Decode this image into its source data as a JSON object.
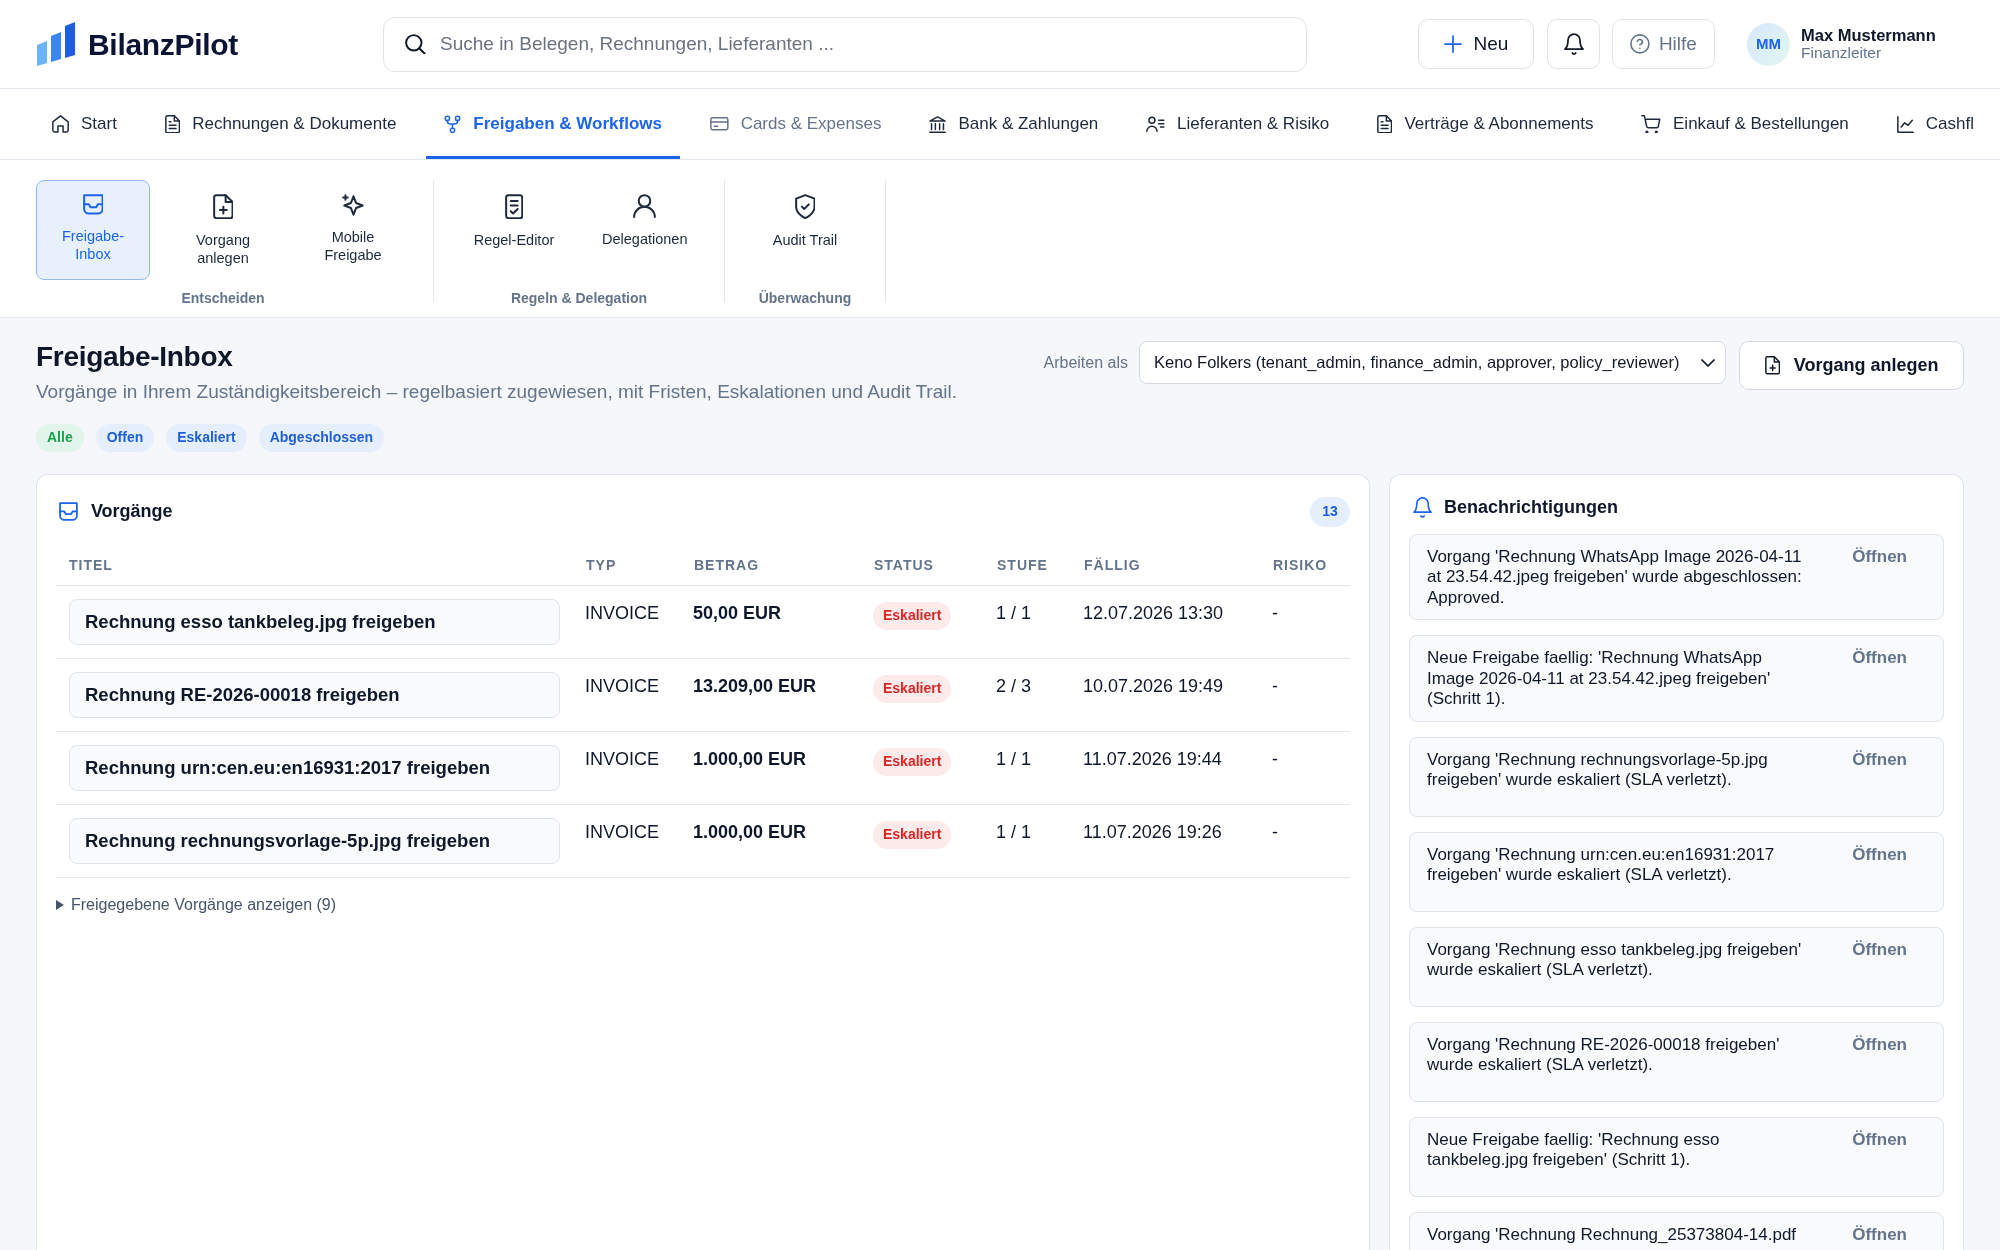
{
  "header": {
    "logo": "BilanzPilot",
    "search": {
      "placeholder": "Suche in Belegen, Rechnungen, Lieferanten ..."
    },
    "new_button": "Neu",
    "help_button": "Hilfe",
    "user": {
      "initials": "MM",
      "name": "Max Mustermann",
      "role": "Finanzleiter"
    }
  },
  "nav": [
    {
      "label": "Start",
      "selected": false,
      "disabled": false
    },
    {
      "label": "Rechnungen & Dokumente",
      "selected": false,
      "disabled": false
    },
    {
      "label": "Freigaben & Workflows",
      "selected": true,
      "disabled": false
    },
    {
      "label": "Cards & Expenses",
      "selected": false,
      "disabled": true
    },
    {
      "label": "Bank & Zahlungen",
      "selected": false,
      "disabled": false
    },
    {
      "label": "Lieferanten & Risiko",
      "selected": false,
      "disabled": false
    },
    {
      "label": "Verträge & Abonnements",
      "selected": false,
      "disabled": false
    },
    {
      "label": "Einkauf & Bestellungen",
      "selected": false,
      "disabled": false
    },
    {
      "label": "Cashfl",
      "selected": false,
      "disabled": false
    }
  ],
  "ribbon": [
    {
      "label": "Entscheiden",
      "items": [
        {
          "label": "Freigabe-Inbox",
          "selected": true
        },
        {
          "label": "Vorgang anlegen",
          "selected": false
        },
        {
          "label": "Mobile Freigabe",
          "selected": false
        }
      ]
    },
    {
      "label": "Regeln & Delegation",
      "items": [
        {
          "label": "Regel-Editor",
          "selected": false
        },
        {
          "label": "Delegationen",
          "selected": false
        }
      ]
    },
    {
      "label": "Überwachung",
      "items": [
        {
          "label": "Audit Trail",
          "selected": false
        }
      ]
    }
  ],
  "page": {
    "title": "Freigabe-Inbox",
    "subtitle": "Vorgänge in Ihrem Zuständigkeitsbereich – regelbasiert zugewiesen, mit Fristen, Eskalationen und Audit Trail.",
    "filters": [
      {
        "label": "Alle",
        "selected": true
      },
      {
        "label": "Offen",
        "selected": false
      },
      {
        "label": "Eskaliert",
        "selected": false
      },
      {
        "label": "Abgeschlossen",
        "selected": false
      }
    ],
    "acting_as": {
      "label": "Arbeiten als",
      "value": "Keno Folkers (tenant_admin, finance_admin, approver, policy_reviewer)"
    },
    "create_button": "Vorgang anlegen"
  },
  "cases": {
    "title": "Vorgänge",
    "count": "13",
    "columns": [
      "TITEL",
      "TYP",
      "BETRAG",
      "STATUS",
      "STUFE",
      "FÄLLIG",
      "RISIKO"
    ],
    "rows": [
      {
        "title": "Rechnung esso tankbeleg.jpg freigeben",
        "type": "INVOICE",
        "amount": "50,00 EUR",
        "status": "Eskaliert",
        "stage": "1 / 1",
        "due": "12.07.2026 13:30",
        "risk": "-"
      },
      {
        "title": "Rechnung RE-2026-00018 freigeben",
        "type": "INVOICE",
        "amount": "13.209,00 EUR",
        "status": "Eskaliert",
        "stage": "2 / 3",
        "due": "10.07.2026 19:49",
        "risk": "-"
      },
      {
        "title": "Rechnung urn:cen.eu:en16931:2017 freigeben",
        "type": "INVOICE",
        "amount": "1.000,00 EUR",
        "status": "Eskaliert",
        "stage": "1 / 1",
        "due": "11.07.2026 19:44",
        "risk": "-"
      },
      {
        "title": "Rechnung rechnungsvorlage-5p.jpg freigeben",
        "type": "INVOICE",
        "amount": "1.000,00 EUR",
        "status": "Eskaliert",
        "stage": "1 / 1",
        "due": "11.07.2026 19:26",
        "risk": "-"
      }
    ],
    "completed_toggle": {
      "label": "Freigegebene Vorgänge anzeigen (9)",
      "expanded": false
    }
  },
  "notifications": {
    "title": "Benachrichtigungen",
    "items": [
      {
        "text": "Vorgang 'Rechnung WhatsApp Image 2026-04-11 at 23.54.42.jpeg freigeben' wurde abgeschlossen: Approved.",
        "action": "Öffnen"
      },
      {
        "text": "Neue Freigabe faellig: 'Rechnung WhatsApp Image 2026-04-11 at 23.54.42.jpeg freigeben' (Schritt 1).",
        "action": "Öffnen"
      },
      {
        "text": "Vorgang 'Rechnung rechnungsvorlage-5p.jpg freigeben' wurde eskaliert (SLA verletzt).",
        "action": "Öffnen"
      },
      {
        "text": "Vorgang 'Rechnung urn:cen.eu:en16931:2017 freigeben' wurde eskaliert (SLA verletzt).",
        "action": "Öffnen"
      },
      {
        "text": "Vorgang 'Rechnung esso tankbeleg.jpg freigeben' wurde eskaliert (SLA verletzt).",
        "action": "Öffnen"
      },
      {
        "text": "Vorgang 'Rechnung RE-2026-00018 freigeben' wurde eskaliert (SLA verletzt).",
        "action": "Öffnen"
      },
      {
        "text": "Neue Freigabe faellig: 'Rechnung esso tankbeleg.jpg freigeben' (Schritt 1).",
        "action": "Öffnen"
      },
      {
        "text": "Vorgang 'Rechnung Rechnung_25373804-14.pdf",
        "action": "Öffnen"
      }
    ]
  }
}
